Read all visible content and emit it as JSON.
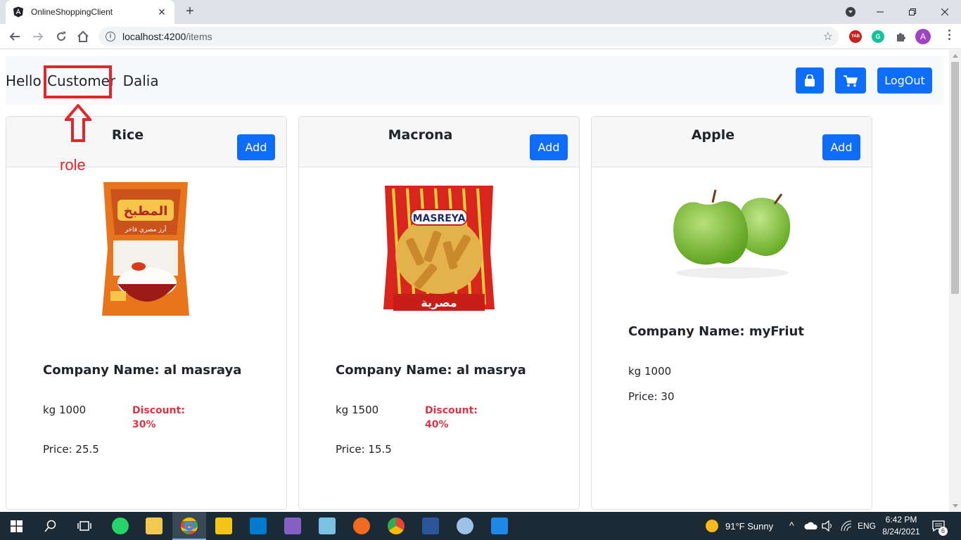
{
  "browser": {
    "tab_title": "OnlineShoppingClient",
    "tab_close": "✕",
    "new_tab": "+",
    "url_host": "localhost:4200",
    "url_path": "/items",
    "profile_initial": "A",
    "ext_yab": "YAB",
    "ext_grammarly": "G"
  },
  "header": {
    "hello": "Hello",
    "role": "Customer",
    "name": "Dalia",
    "logout_label": "LogOut"
  },
  "annotation": {
    "label": "role",
    "color": "#e3262d"
  },
  "items": [
    {
      "title": "Rice",
      "add_label": "Add",
      "company": "Company Name: al masraya",
      "quantity": "kg 1000",
      "discount_line1": "Discount:",
      "discount_line2": "30%",
      "price": "Price: 25.5"
    },
    {
      "title": "Macrona",
      "add_label": "Add",
      "company": "Company Name: al masrya",
      "quantity": "kg 1500",
      "discount_line1": "Discount:",
      "discount_line2": "40%",
      "price": "Price: 15.5"
    },
    {
      "title": "Apple",
      "add_label": "Add",
      "company": "Company Name: myFriut",
      "quantity": "kg 1000",
      "price": "Price: 30"
    }
  ],
  "rice_packaging_text": {
    "brand": "المطبخ",
    "subtitle": "أرز مصري فاخر"
  },
  "pasta_packaging_text": {
    "brand": "MASREYA",
    "arabic": "مصرية"
  },
  "taskbar": {
    "weather": "91°F  Sunny",
    "lang": "ENG",
    "time": "6:42 PM",
    "date": "8/24/2021",
    "notifications": "6"
  },
  "colors": {
    "primary": "#0d6efd",
    "danger": "#dc3545",
    "navbar_bg": "#f8f9fa"
  }
}
